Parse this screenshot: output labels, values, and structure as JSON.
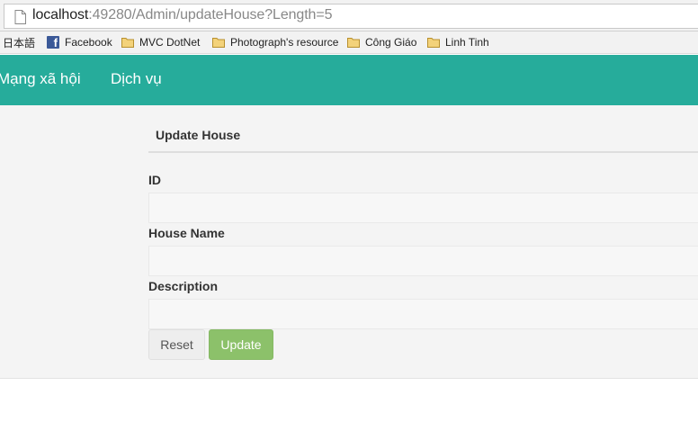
{
  "browser": {
    "url_host": "localhost",
    "url_path": ":49280/Admin/updateHouse?Length=5"
  },
  "bookmarks": [
    {
      "label": "日本語",
      "icon": "none"
    },
    {
      "label": "Facebook",
      "icon": "facebook-icon"
    },
    {
      "label": "MVC DotNet",
      "icon": "folder-icon"
    },
    {
      "label": "Photograph's resource",
      "icon": "folder-icon"
    },
    {
      "label": "Công Giáo",
      "icon": "folder-icon"
    },
    {
      "label": "Linh Tinh",
      "icon": "folder-icon"
    }
  ],
  "navbar": {
    "color": "#26ac9b",
    "links": [
      "Mạng xã hội",
      "Dịch vụ"
    ]
  },
  "form": {
    "title": "Update House",
    "fields": [
      {
        "label": "ID",
        "value": "",
        "placeholder": ""
      },
      {
        "label": "House Name",
        "value": "",
        "placeholder": ""
      },
      {
        "label": "Description",
        "value": "",
        "placeholder": ""
      }
    ],
    "reset_label": "Reset",
    "update_label": "Update",
    "update_color": "#8cc16a"
  }
}
